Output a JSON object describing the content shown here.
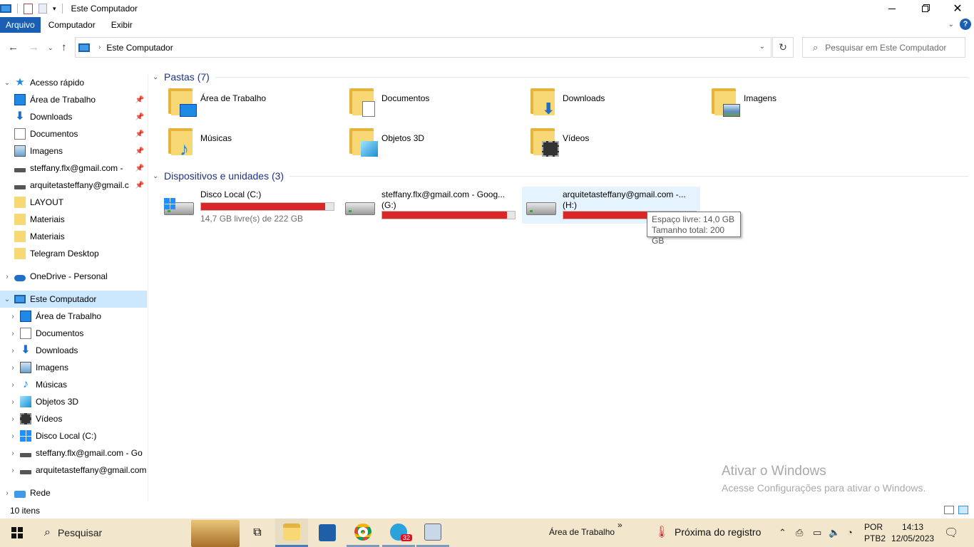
{
  "window": {
    "title": "Este Computador",
    "minimize_icon": "minimize-icon",
    "maximize_icon": "restore-icon",
    "close_icon": "close-icon"
  },
  "ribbon": {
    "tabs": [
      "Arquivo",
      "Computador",
      "Exibir"
    ],
    "help": "?"
  },
  "address": {
    "path": "Este Computador"
  },
  "search": {
    "placeholder": "Pesquisar em Este Computador"
  },
  "sidebar": {
    "quick_access": "Acesso rápido",
    "quick_items": [
      {
        "label": "Área de Trabalho",
        "icon": "desktop-icon",
        "pinned": true
      },
      {
        "label": "Downloads",
        "icon": "download-icon",
        "pinned": true
      },
      {
        "label": "Documentos",
        "icon": "document-icon",
        "pinned": true
      },
      {
        "label": "Imagens",
        "icon": "pictures-icon",
        "pinned": true
      },
      {
        "label": "steffany.flx@gmail.com -",
        "icon": "drive-icon",
        "pinned": true
      },
      {
        "label": "arquitetasteffany@gmail.c",
        "icon": "drive-icon",
        "pinned": true
      },
      {
        "label": "LAYOUT",
        "icon": "folder-icon",
        "pinned": false
      },
      {
        "label": "Materiais",
        "icon": "folder-icon",
        "pinned": false
      },
      {
        "label": "Materiais",
        "icon": "folder-icon",
        "pinned": false
      },
      {
        "label": "Telegram Desktop",
        "icon": "folder-icon",
        "pinned": false
      }
    ],
    "onedrive": "OneDrive - Personal",
    "this_pc": "Este Computador",
    "pc_items": [
      {
        "label": "Área de Trabalho",
        "icon": "desktop-icon"
      },
      {
        "label": "Documentos",
        "icon": "document-icon"
      },
      {
        "label": "Downloads",
        "icon": "download-icon"
      },
      {
        "label": "Imagens",
        "icon": "pictures-icon"
      },
      {
        "label": "Músicas",
        "icon": "music-icon"
      },
      {
        "label": "Objetos 3D",
        "icon": "3d-objects-icon"
      },
      {
        "label": "Vídeos",
        "icon": "video-icon"
      },
      {
        "label": "Disco Local (C:)",
        "icon": "windows-drive-icon"
      },
      {
        "label": "steffany.flx@gmail.com - Go",
        "icon": "drive-icon"
      },
      {
        "label": "arquitetasteffany@gmail.com",
        "icon": "drive-icon"
      }
    ],
    "network": "Rede"
  },
  "content": {
    "folders_header": "Pastas (7)",
    "folders": [
      {
        "label": "Área de Trabalho",
        "icon": "desktop-folder-icon"
      },
      {
        "label": "Documentos",
        "icon": "documents-folder-icon"
      },
      {
        "label": "Downloads",
        "icon": "downloads-folder-icon"
      },
      {
        "label": "Imagens",
        "icon": "pictures-folder-icon"
      },
      {
        "label": "Músicas",
        "icon": "music-folder-icon"
      },
      {
        "label": "Objetos 3D",
        "icon": "3d-objects-folder-icon"
      },
      {
        "label": "Vídeos",
        "icon": "videos-folder-icon"
      }
    ],
    "devices_header": "Dispositivos e unidades (3)",
    "drives": [
      {
        "name": "Disco Local (C:)",
        "free_text": "14,7 GB livre(s) de 222 GB",
        "used_fraction": 0.934
      },
      {
        "name": "steffany.flx@gmail.com - Goog... (G:)",
        "free_text": "",
        "used_fraction": 0.94
      },
      {
        "name": "arquitetasteffany@gmail.com -... (H:)",
        "free_text": "",
        "used_fraction": 0.93
      }
    ],
    "tooltip": {
      "line1": "Espaço livre: 14,0 GB",
      "line2": "Tamanho total: 200 GB"
    }
  },
  "status": {
    "count": "10 itens"
  },
  "watermark": {
    "title": "Ativar o Windows",
    "subtitle": "Acesse Configurações para ativar o Windows."
  },
  "taskbar": {
    "search_label": "Pesquisar",
    "desktop_label": "Área de Trabalho",
    "overflow": "»",
    "weather": "Próxima do registro",
    "telegram_badge": "32",
    "lang_top": "POR",
    "lang_bottom": "PTB2",
    "time": "14:13",
    "date": "12/05/2023"
  },
  "colors": {
    "accent": "#1a5fb4",
    "bar_full": "#da2626",
    "taskbar": "#f2e6cc",
    "selection": "#cce8ff"
  }
}
